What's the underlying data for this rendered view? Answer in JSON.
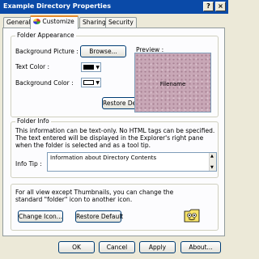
{
  "window": {
    "title": "Example Directory Properties",
    "help_btn": "?",
    "close_btn": "×"
  },
  "tabs": [
    {
      "label": "General"
    },
    {
      "label": "Customize"
    },
    {
      "label": "Sharing"
    },
    {
      "label": "Security"
    }
  ],
  "folder_appearance": {
    "legend": "Folder Appearance",
    "bg_picture_label": "Background Picture :",
    "browse_label": "Browse...",
    "text_color_label": "Text Color :",
    "text_color": "#000000",
    "bg_color_label": "Background Color :",
    "bg_color": "#ffffff",
    "restore_default_label": "Restore Default",
    "preview_label": "Preview :",
    "preview_filename": "Filename"
  },
  "folder_info": {
    "legend": "Folder Info",
    "description": "This information can be text-only. No HTML tags can be specified. The text entered will be displayed in the Explorer's right pane when the folder is selected and as a tool tip.",
    "info_tip_label": "Info Tip :",
    "info_tip_value": "Information about Directory Contents"
  },
  "icon_section": {
    "description": "For all view except Thumbnails, you can change the standard \"folder\" icon to another icon.",
    "change_icon_label": "Change Icon...",
    "restore_default_label": "Restore Default"
  },
  "footer": {
    "ok_label": "OK",
    "cancel_label": "Cancel",
    "apply_label": "Apply",
    "about_label": "About..."
  }
}
